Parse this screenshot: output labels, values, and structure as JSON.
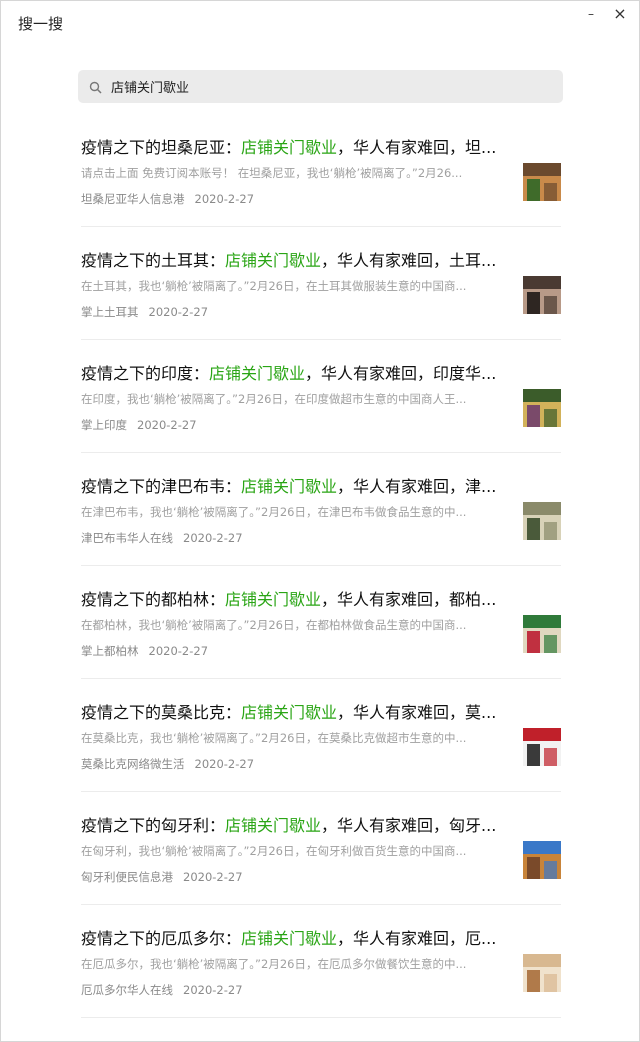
{
  "window": {
    "title": "搜一搜",
    "minimize_glyph": "–",
    "close_glyph": "×"
  },
  "search": {
    "query": "店铺关门歇业",
    "icon": "search-icon"
  },
  "results": [
    {
      "prefix": "疫情之下的坦桑尼亚：",
      "highlight": "店铺关门歇业",
      "suffix": "，华人有家难回，坦...",
      "desc": "请点击上面 免费订阅本账号！ 在坦桑尼亚，我也‘躺枪’被隔离了。”2月26...",
      "source": "坦桑尼亚华人信息港",
      "date": "2020-2-27",
      "thumb_colors": [
        "#6b4a2e",
        "#c98a4a",
        "#3f6b2a"
      ]
    },
    {
      "prefix": "疫情之下的土耳其：",
      "highlight": "店铺关门歇业",
      "suffix": "，华人有家难回，土耳...",
      "desc": "在土耳其，我也‘躺枪’被隔离了。”2月26日，在土耳其做服装生意的中国商...",
      "source": "掌上土耳其",
      "date": "2020-2-27",
      "thumb_colors": [
        "#4a3a32",
        "#b89a88",
        "#2e2622"
      ]
    },
    {
      "prefix": "疫情之下的印度：",
      "highlight": "店铺关门歇业",
      "suffix": "，华人有家难回，印度华...",
      "desc": "在印度，我也‘躺枪’被隔离了。”2月26日，在印度做超市生意的中国商人王...",
      "source": "掌上印度",
      "date": "2020-2-27",
      "thumb_colors": [
        "#3b5c2a",
        "#d2b25a",
        "#7a4a6a"
      ]
    },
    {
      "prefix": "疫情之下的津巴布韦：",
      "highlight": "店铺关门歇业",
      "suffix": "，华人有家难回，津...",
      "desc": "在津巴布韦，我也‘躺枪’被隔离了。”2月26日，在津巴布韦做食品生意的中...",
      "source": "津巴布韦华人在线",
      "date": "2020-2-27",
      "thumb_colors": [
        "#8a8a6a",
        "#d8d2b8",
        "#4a5a3a"
      ]
    },
    {
      "prefix": "疫情之下的都柏林：",
      "highlight": "店铺关门歇业",
      "suffix": "，华人有家难回，都柏...",
      "desc": "在都柏林，我也‘躺枪’被隔离了。”2月26日，在都柏林做食品生意的中国商...",
      "source": "掌上都柏林",
      "date": "2020-2-27",
      "thumb_colors": [
        "#2f7a3a",
        "#e0d8c0",
        "#c03040"
      ]
    },
    {
      "prefix": "疫情之下的莫桑比克：",
      "highlight": "店铺关门歇业",
      "suffix": "，华人有家难回，莫...",
      "desc": "在莫桑比克，我也‘躺枪’被隔离了。”2月26日，在莫桑比克做超市生意的中...",
      "source": "莫桑比克网络微生活",
      "date": "2020-2-27",
      "thumb_colors": [
        "#c0202a",
        "#f2f2f2",
        "#3a3a3a"
      ]
    },
    {
      "prefix": "疫情之下的匈牙利：",
      "highlight": "店铺关门歇业",
      "suffix": "，华人有家难回，匈牙...",
      "desc": "在匈牙利，我也‘躺枪’被隔离了。”2月26日，在匈牙利做百货生意的中国商...",
      "source": "匈牙利便民信息港",
      "date": "2020-2-27",
      "thumb_colors": [
        "#3a78c8",
        "#c8843a",
        "#7a4a2a"
      ]
    },
    {
      "prefix": "疫情之下的厄瓜多尔：",
      "highlight": "店铺关门歇业",
      "suffix": "，华人有家难回，厄...",
      "desc": "在厄瓜多尔，我也‘躺枪’被隔离了。”2月26日，在厄瓜多尔做餐饮生意的中...",
      "source": "厄瓜多尔华人在线",
      "date": "2020-2-27",
      "thumb_colors": [
        "#d8b890",
        "#f0e2cc",
        "#b07a4a"
      ]
    }
  ],
  "colors": {
    "highlight": "#2aa515",
    "search_bg": "#ebebeb",
    "desc": "#a0a0a0",
    "meta": "#8a8a8a"
  }
}
